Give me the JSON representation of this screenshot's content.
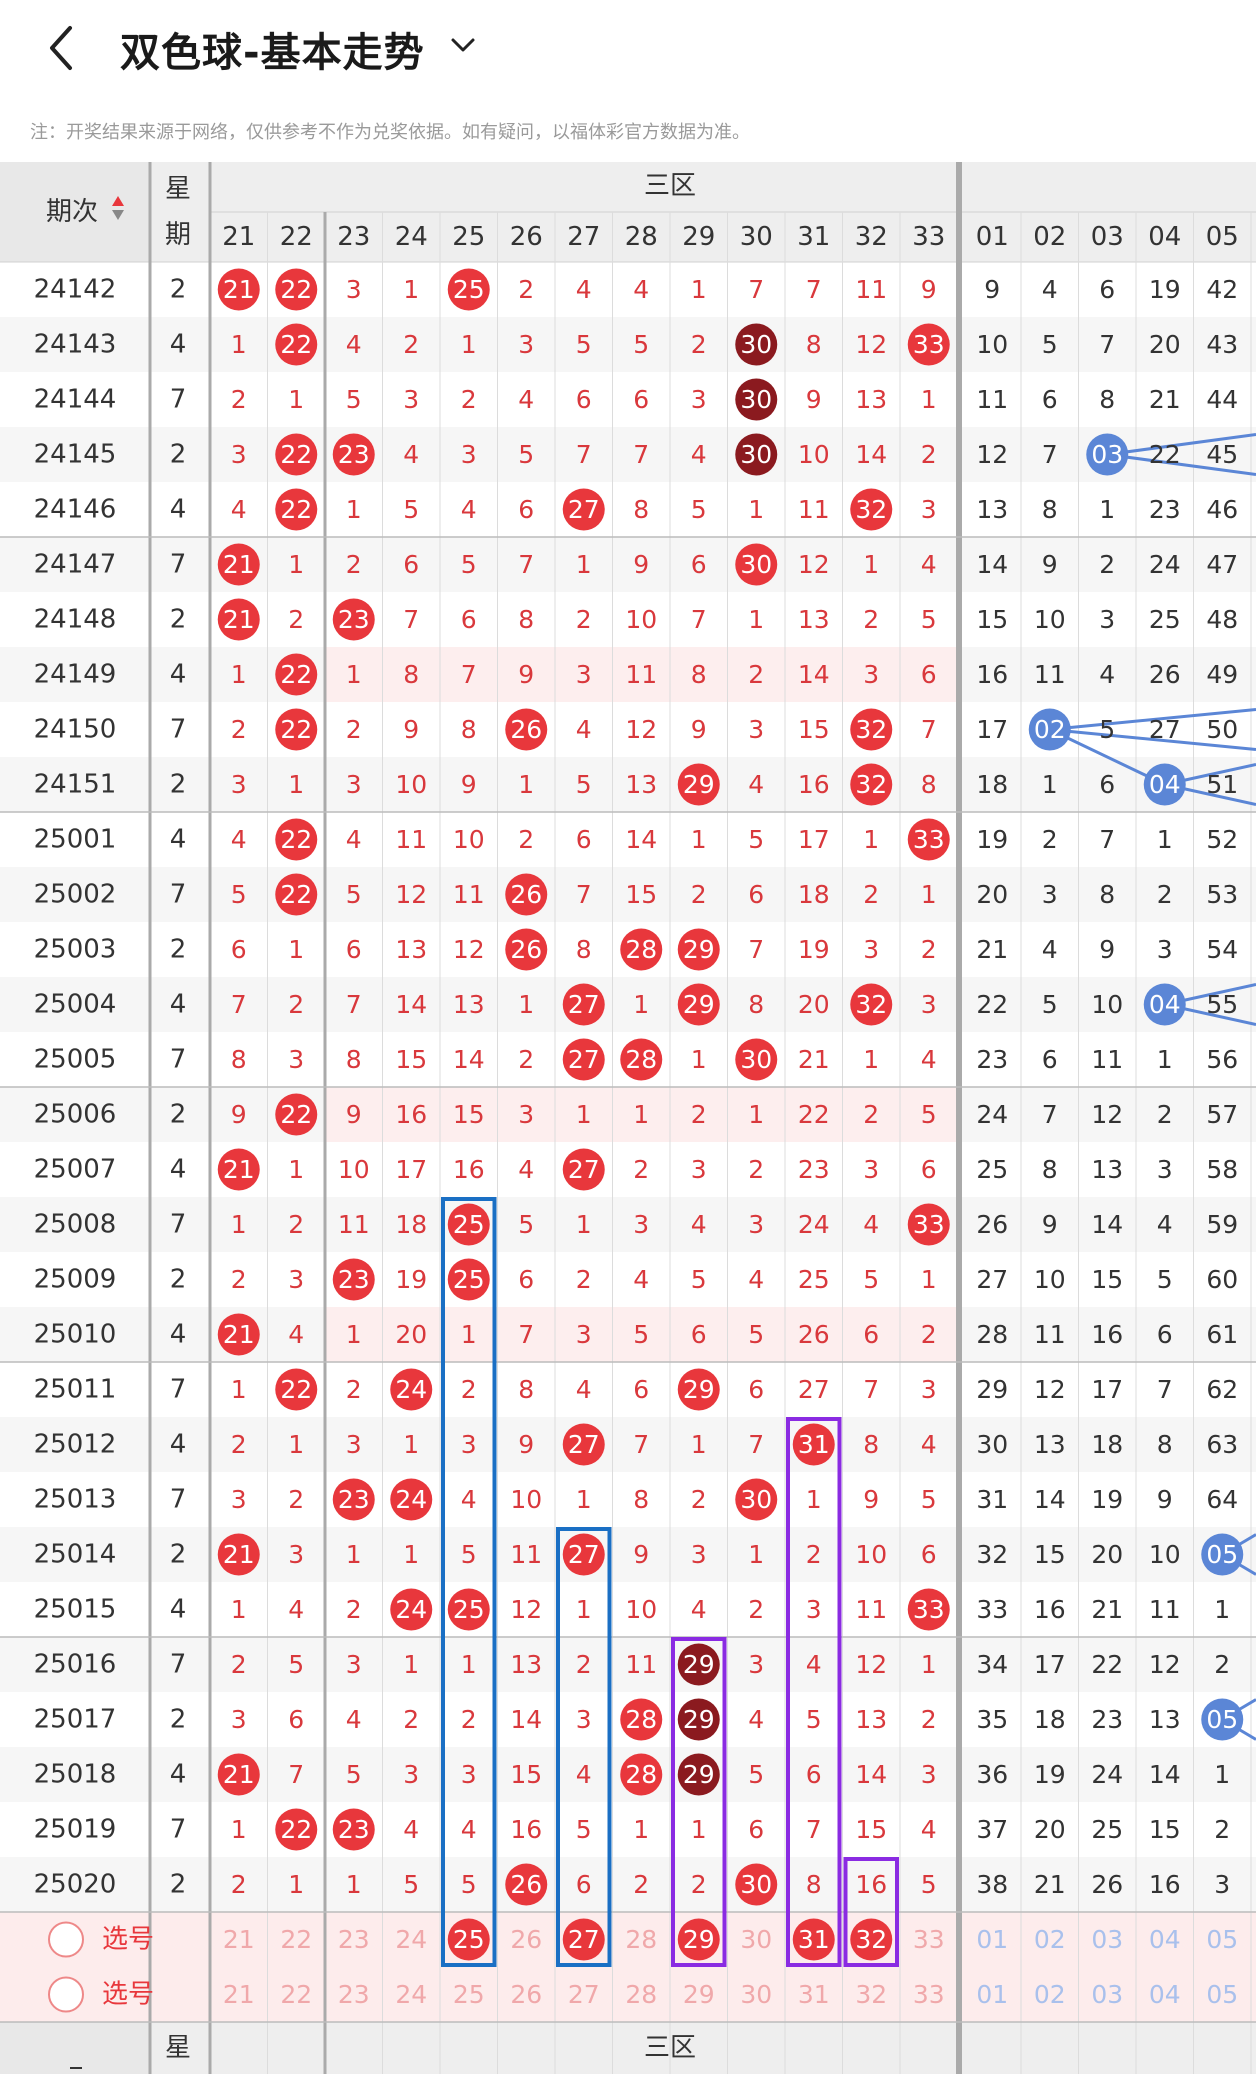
{
  "header": {
    "title": "双色球-基本走势",
    "note": "注：开奖结果来源于网络，仅供参考不作为兑奖依据。如有疑问，以福体彩官方数据为准。"
  },
  "table": {
    "col_period": "期次",
    "col_week": "星期",
    "zone_label": "三区",
    "red_cols": [
      "21",
      "22",
      "23",
      "24",
      "25",
      "26",
      "27",
      "28",
      "29",
      "30",
      "31",
      "32",
      "33"
    ],
    "blue_cols": [
      "01",
      "02",
      "03",
      "04",
      "05"
    ],
    "rows": [
      {
        "period": "24142",
        "week": "2",
        "red": [
          "21",
          "22",
          "3",
          "1",
          "25",
          "2",
          "4",
          "4",
          "1",
          "7",
          "7",
          "11",
          "9"
        ],
        "blue": [
          "9",
          "4",
          "6",
          "19",
          "42"
        ]
      },
      {
        "period": "24143",
        "week": "4",
        "red": [
          "1",
          "22",
          "4",
          "2",
          "1",
          "3",
          "5",
          "5",
          "2",
          "30",
          "8",
          "12",
          "33"
        ],
        "blue": [
          "10",
          "5",
          "7",
          "20",
          "43"
        ]
      },
      {
        "period": "24144",
        "week": "7",
        "red": [
          "2",
          "1",
          "5",
          "3",
          "2",
          "4",
          "6",
          "6",
          "3",
          "30",
          "9",
          "13",
          "1"
        ],
        "blue": [
          "11",
          "6",
          "8",
          "21",
          "44"
        ]
      },
      {
        "period": "24145",
        "week": "2",
        "red": [
          "3",
          "22",
          "23",
          "4",
          "3",
          "5",
          "7",
          "7",
          "4",
          "30",
          "10",
          "14",
          "2"
        ],
        "blue": [
          "12",
          "7",
          "03",
          "22",
          "45"
        ]
      },
      {
        "period": "24146",
        "week": "4",
        "red": [
          "4",
          "22",
          "1",
          "5",
          "4",
          "6",
          "27",
          "8",
          "5",
          "1",
          "11",
          "32",
          "3"
        ],
        "blue": [
          "13",
          "8",
          "1",
          "23",
          "46"
        ]
      },
      {
        "period": "24147",
        "week": "7",
        "red": [
          "21",
          "1",
          "2",
          "6",
          "5",
          "7",
          "1",
          "9",
          "6",
          "30",
          "12",
          "1",
          "4"
        ],
        "blue": [
          "14",
          "9",
          "2",
          "24",
          "47"
        ]
      },
      {
        "period": "24148",
        "week": "2",
        "red": [
          "21",
          "2",
          "23",
          "7",
          "6",
          "8",
          "2",
          "10",
          "7",
          "1",
          "13",
          "2",
          "5"
        ],
        "blue": [
          "15",
          "10",
          "3",
          "25",
          "48"
        ]
      },
      {
        "period": "24149",
        "week": "4",
        "red": [
          "1",
          "22",
          "1",
          "8",
          "7",
          "9",
          "3",
          "11",
          "8",
          "2",
          "14",
          "3",
          "6"
        ],
        "blue": [
          "16",
          "11",
          "4",
          "26",
          "49"
        ]
      },
      {
        "period": "24150",
        "week": "7",
        "red": [
          "2",
          "22",
          "2",
          "9",
          "8",
          "26",
          "4",
          "12",
          "9",
          "3",
          "15",
          "32",
          "7"
        ],
        "blue": [
          "17",
          "02",
          "5",
          "27",
          "50"
        ]
      },
      {
        "period": "24151",
        "week": "2",
        "red": [
          "3",
          "1",
          "3",
          "10",
          "9",
          "1",
          "5",
          "13",
          "29",
          "4",
          "16",
          "32",
          "8"
        ],
        "blue": [
          "18",
          "1",
          "6",
          "04",
          "51"
        ]
      },
      {
        "period": "25001",
        "week": "4",
        "red": [
          "4",
          "22",
          "4",
          "11",
          "10",
          "2",
          "6",
          "14",
          "1",
          "5",
          "17",
          "1",
          "33"
        ],
        "blue": [
          "19",
          "2",
          "7",
          "1",
          "52"
        ]
      },
      {
        "period": "25002",
        "week": "7",
        "red": [
          "5",
          "22",
          "5",
          "12",
          "11",
          "26",
          "7",
          "15",
          "2",
          "6",
          "18",
          "2",
          "1"
        ],
        "blue": [
          "20",
          "3",
          "8",
          "2",
          "53"
        ]
      },
      {
        "period": "25003",
        "week": "2",
        "red": [
          "6",
          "1",
          "6",
          "13",
          "12",
          "26",
          "8",
          "28",
          "29",
          "7",
          "19",
          "3",
          "2"
        ],
        "blue": [
          "21",
          "4",
          "9",
          "3",
          "54"
        ]
      },
      {
        "period": "25004",
        "week": "4",
        "red": [
          "7",
          "2",
          "7",
          "14",
          "13",
          "1",
          "27",
          "1",
          "29",
          "8",
          "20",
          "32",
          "3"
        ],
        "blue": [
          "22",
          "5",
          "10",
          "04",
          "55"
        ]
      },
      {
        "period": "25005",
        "week": "7",
        "red": [
          "8",
          "3",
          "8",
          "15",
          "14",
          "2",
          "27",
          "28",
          "1",
          "30",
          "21",
          "1",
          "4"
        ],
        "blue": [
          "23",
          "6",
          "11",
          "1",
          "56"
        ]
      },
      {
        "period": "25006",
        "week": "2",
        "red": [
          "9",
          "22",
          "9",
          "16",
          "15",
          "3",
          "1",
          "1",
          "2",
          "1",
          "22",
          "2",
          "5"
        ],
        "blue": [
          "24",
          "7",
          "12",
          "2",
          "57"
        ]
      },
      {
        "period": "25007",
        "week": "4",
        "red": [
          "21",
          "1",
          "10",
          "17",
          "16",
          "4",
          "27",
          "2",
          "3",
          "2",
          "23",
          "3",
          "6"
        ],
        "blue": [
          "25",
          "8",
          "13",
          "3",
          "58"
        ]
      },
      {
        "period": "25008",
        "week": "7",
        "red": [
          "1",
          "2",
          "11",
          "18",
          "25",
          "5",
          "1",
          "3",
          "4",
          "3",
          "24",
          "4",
          "33"
        ],
        "blue": [
          "26",
          "9",
          "14",
          "4",
          "59"
        ]
      },
      {
        "period": "25009",
        "week": "2",
        "red": [
          "2",
          "3",
          "23",
          "19",
          "25",
          "6",
          "2",
          "4",
          "5",
          "4",
          "25",
          "5",
          "1"
        ],
        "blue": [
          "27",
          "10",
          "15",
          "5",
          "60"
        ]
      },
      {
        "period": "25010",
        "week": "4",
        "red": [
          "21",
          "4",
          "1",
          "20",
          "1",
          "7",
          "3",
          "5",
          "6",
          "5",
          "26",
          "6",
          "2"
        ],
        "blue": [
          "28",
          "11",
          "16",
          "6",
          "61"
        ]
      },
      {
        "period": "25011",
        "week": "7",
        "red": [
          "1",
          "22",
          "2",
          "24",
          "2",
          "8",
          "4",
          "6",
          "29",
          "6",
          "27",
          "7",
          "3"
        ],
        "blue": [
          "29",
          "12",
          "17",
          "7",
          "62"
        ]
      },
      {
        "period": "25012",
        "week": "4",
        "red": [
          "2",
          "1",
          "3",
          "1",
          "3",
          "9",
          "27",
          "7",
          "1",
          "7",
          "31",
          "8",
          "4"
        ],
        "blue": [
          "30",
          "13",
          "18",
          "8",
          "63"
        ]
      },
      {
        "period": "25013",
        "week": "7",
        "red": [
          "3",
          "2",
          "23",
          "24",
          "4",
          "10",
          "1",
          "8",
          "2",
          "30",
          "1",
          "9",
          "5"
        ],
        "blue": [
          "31",
          "14",
          "19",
          "9",
          "64"
        ]
      },
      {
        "period": "25014",
        "week": "2",
        "red": [
          "21",
          "3",
          "1",
          "1",
          "5",
          "11",
          "27",
          "9",
          "3",
          "1",
          "2",
          "10",
          "6"
        ],
        "blue": [
          "32",
          "15",
          "20",
          "10",
          "05"
        ]
      },
      {
        "period": "25015",
        "week": "4",
        "red": [
          "1",
          "4",
          "2",
          "24",
          "25",
          "12",
          "1",
          "10",
          "4",
          "2",
          "3",
          "11",
          "33"
        ],
        "blue": [
          "33",
          "16",
          "21",
          "11",
          "1"
        ]
      },
      {
        "period": "25016",
        "week": "7",
        "red": [
          "2",
          "5",
          "3",
          "1",
          "1",
          "13",
          "2",
          "11",
          "29",
          "3",
          "4",
          "12",
          "1"
        ],
        "blue": [
          "34",
          "17",
          "22",
          "12",
          "2"
        ]
      },
      {
        "period": "25017",
        "week": "2",
        "red": [
          "3",
          "6",
          "4",
          "2",
          "2",
          "14",
          "3",
          "28",
          "29",
          "4",
          "5",
          "13",
          "2"
        ],
        "blue": [
          "35",
          "18",
          "23",
          "13",
          "05"
        ]
      },
      {
        "period": "25018",
        "week": "4",
        "red": [
          "21",
          "7",
          "5",
          "3",
          "3",
          "15",
          "4",
          "28",
          "29",
          "5",
          "6",
          "14",
          "3"
        ],
        "blue": [
          "36",
          "19",
          "24",
          "14",
          "1"
        ]
      },
      {
        "period": "25019",
        "week": "7",
        "red": [
          "1",
          "22",
          "23",
          "4",
          "4",
          "16",
          "5",
          "1",
          "1",
          "6",
          "7",
          "15",
          "4"
        ],
        "blue": [
          "37",
          "20",
          "25",
          "15",
          "2"
        ]
      },
      {
        "period": "25020",
        "week": "2",
        "red": [
          "2",
          "1",
          "1",
          "5",
          "5",
          "26",
          "6",
          "2",
          "2",
          "30",
          "8",
          "16",
          "5"
        ],
        "blue": [
          "38",
          "21",
          "26",
          "16",
          "3"
        ]
      }
    ],
    "select_rows": [
      {
        "label": "选号",
        "red": [
          "21",
          "22",
          "23",
          "24",
          "25",
          "26",
          "27",
          "28",
          "29",
          "30",
          "31",
          "32",
          "33"
        ],
        "blue": [
          "01",
          "02",
          "03",
          "04",
          "05"
        ],
        "picked": [
          "25",
          "27",
          "29",
          "31",
          "32"
        ]
      },
      {
        "label": "选号",
        "red": [
          "21",
          "22",
          "23",
          "24",
          "25",
          "26",
          "27",
          "28",
          "29",
          "30",
          "31",
          "32",
          "33"
        ],
        "blue": [
          "01",
          "02",
          "03",
          "04",
          "05"
        ],
        "picked": []
      }
    ]
  },
  "colors": {
    "red_ball": "#e8373c",
    "dark_ball": "#8b1a1f",
    "blue_ball": "#5b86d6",
    "miss_red": "#d9383c",
    "blue_box": "#1a6fc4",
    "purple_box": "#8a2be2",
    "header_bg": "#eeeeee",
    "select_bg": "#fdecec"
  }
}
